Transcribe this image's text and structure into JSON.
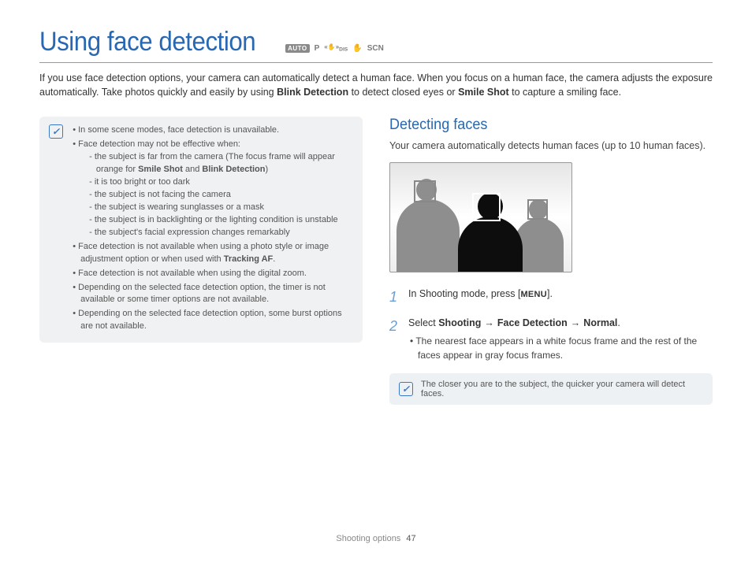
{
  "title": "Using face detection",
  "mode_icons": {
    "auto": "AUTO",
    "p": "P",
    "dis": "DIS",
    "timer": " ",
    "scn": "SCN"
  },
  "intro": {
    "p1": "If you use face detection options, your camera can automatically detect a human face. When you focus on a human face, the camera adjusts the exposure automatically. Take photos quickly and easily by using ",
    "b1": "Blink Detection",
    "p2": " to detect closed eyes or ",
    "b2": "Smile Shot",
    "p3": " to capture a smiling face."
  },
  "note": {
    "items": [
      "In some scene modes, face detection is unavailable.",
      "Face detection may not be effective when:"
    ],
    "sub": {
      "s1a": "the subject is far from the camera (The focus frame will appear orange for ",
      "s1b1": "Smile Shot",
      "s1c": " and ",
      "s1b2": "Blink Detection",
      "s1d": ")",
      "s2": "it is too bright or too dark",
      "s3": "the subject is not facing the camera",
      "s4": "the subject is wearing sunglasses or a mask",
      "s5": "the subject is in backlighting or the lighting condition is unstable",
      "s6": "the subject's facial expression changes remarkably"
    },
    "items2": {
      "i3a": "Face detection is not available when using a photo style or image adjustment option or when used with ",
      "i3b": "Tracking AF",
      "i3c": ".",
      "i4": "Face detection is not available when using the digital zoom.",
      "i5": "Depending on the selected face detection option, the timer is not available or some timer options are not available.",
      "i6": "Depending on the selected face detection option, some burst options are not available."
    }
  },
  "right": {
    "heading": "Detecting faces",
    "lead": "Your camera automatically detects human faces (up to 10 human faces).",
    "step1": {
      "pre": "In Shooting mode, press [",
      "btn": "MENU",
      "post": "]."
    },
    "step2": {
      "pre": "Select ",
      "b1": "Shooting",
      "arrow": "→",
      "b2": "Face Detection",
      "b3": "Normal",
      "post": ".",
      "sub": "The nearest face appears in a white focus frame and the rest of the faces appear in gray focus frames."
    },
    "tip": "The closer you are to the subject, the quicker your camera will detect faces."
  },
  "footer": {
    "section": "Shooting options",
    "page": "47"
  }
}
